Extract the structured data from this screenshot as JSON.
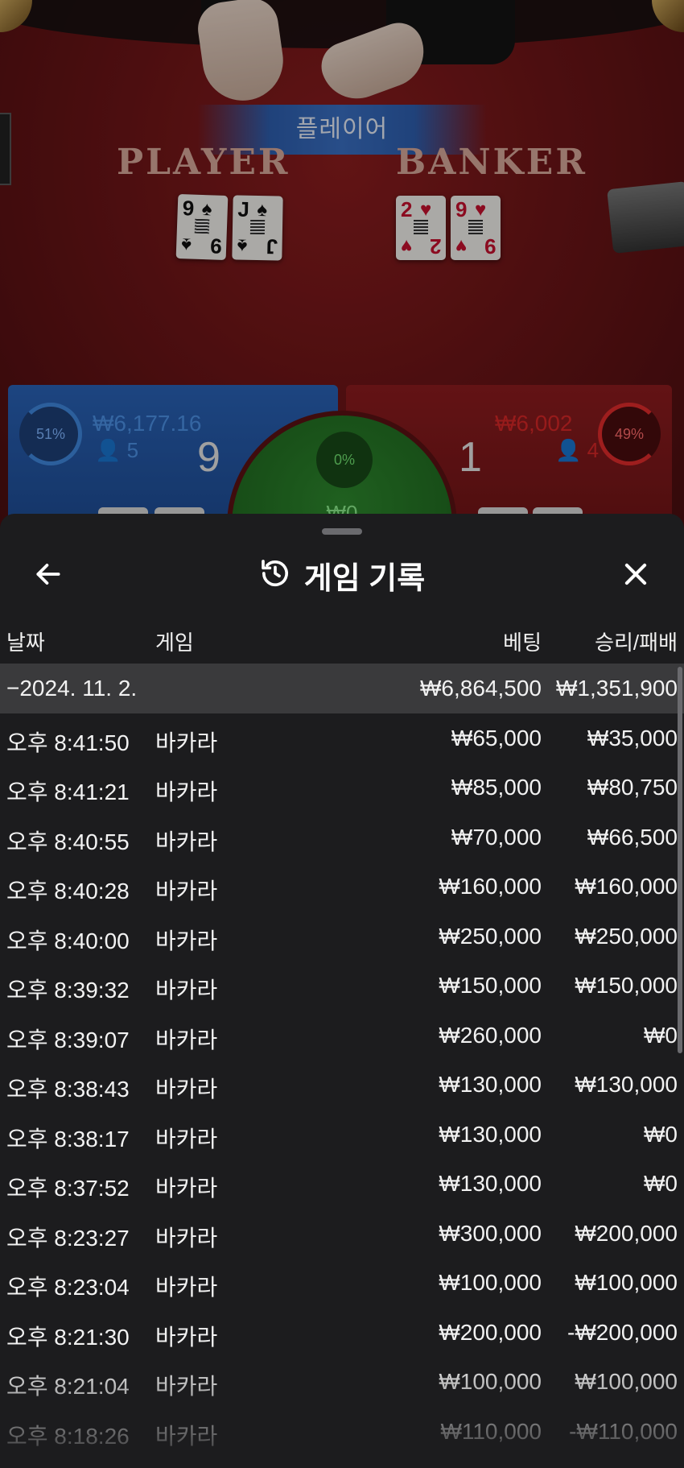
{
  "game": {
    "winner_banner": "플레이어",
    "player_label": "PLAYER",
    "banker_label": "BANKER",
    "player_cards": [
      {
        "rank": "9",
        "suit": "♠"
      },
      {
        "rank": "J",
        "suit": "♠"
      }
    ],
    "banker_cards": [
      {
        "rank": "2",
        "suit": "♥"
      },
      {
        "rank": "9",
        "suit": "♥"
      }
    ],
    "player_panel": {
      "percent": "51%",
      "amount": "₩6,177.16",
      "bettors": "5",
      "score": "9"
    },
    "banker_panel": {
      "percent": "49%",
      "amount": "₩6,002",
      "bettors": "4",
      "score": "1"
    },
    "tie_panel": {
      "percent": "0%",
      "amount": "₩0"
    }
  },
  "history": {
    "title": "게임 기록",
    "columns": {
      "date": "날짜",
      "game": "게임",
      "bet": "베팅",
      "result": "승리/패배"
    },
    "summary": {
      "date": "−2024. 11. 2.",
      "bet": "₩6,864,500",
      "result": "₩1,351,900"
    },
    "rows": [
      {
        "time": "오후 8:41:50",
        "game": "바카라",
        "bet": "₩65,000",
        "result": "₩35,000"
      },
      {
        "time": "오후 8:41:21",
        "game": "바카라",
        "bet": "₩85,000",
        "result": "₩80,750"
      },
      {
        "time": "오후 8:40:55",
        "game": "바카라",
        "bet": "₩70,000",
        "result": "₩66,500"
      },
      {
        "time": "오후 8:40:28",
        "game": "바카라",
        "bet": "₩160,000",
        "result": "₩160,000"
      },
      {
        "time": "오후 8:40:00",
        "game": "바카라",
        "bet": "₩250,000",
        "result": "₩250,000"
      },
      {
        "time": "오후 8:39:32",
        "game": "바카라",
        "bet": "₩150,000",
        "result": "₩150,000"
      },
      {
        "time": "오후 8:39:07",
        "game": "바카라",
        "bet": "₩260,000",
        "result": "₩0"
      },
      {
        "time": "오후 8:38:43",
        "game": "바카라",
        "bet": "₩130,000",
        "result": "₩130,000"
      },
      {
        "time": "오후 8:38:17",
        "game": "바카라",
        "bet": "₩130,000",
        "result": "₩0"
      },
      {
        "time": "오후 8:37:52",
        "game": "바카라",
        "bet": "₩130,000",
        "result": "₩0"
      },
      {
        "time": "오후 8:23:27",
        "game": "바카라",
        "bet": "₩300,000",
        "result": "₩200,000"
      },
      {
        "time": "오후 8:23:04",
        "game": "바카라",
        "bet": "₩100,000",
        "result": "₩100,000"
      },
      {
        "time": "오후 8:21:30",
        "game": "바카라",
        "bet": "₩200,000",
        "result": "-₩200,000"
      },
      {
        "time": "오후 8:21:04",
        "game": "바카라",
        "bet": "₩100,000",
        "result": "₩100,000"
      },
      {
        "time": "오후 8:18:26",
        "game": "바카라",
        "bet": "₩110,000",
        "result": "-₩110,000"
      }
    ]
  },
  "icons": {
    "back": "arrow-left-icon",
    "history": "history-clock-icon",
    "close": "close-icon",
    "person": "person-icon"
  },
  "colors": {
    "player_blue": "#2a63b8",
    "banker_red": "#8e1c1f",
    "tie_green": "#2e8a2e",
    "sheet_bg": "#1c1c1e",
    "summary_row": "#3a3a3c"
  }
}
